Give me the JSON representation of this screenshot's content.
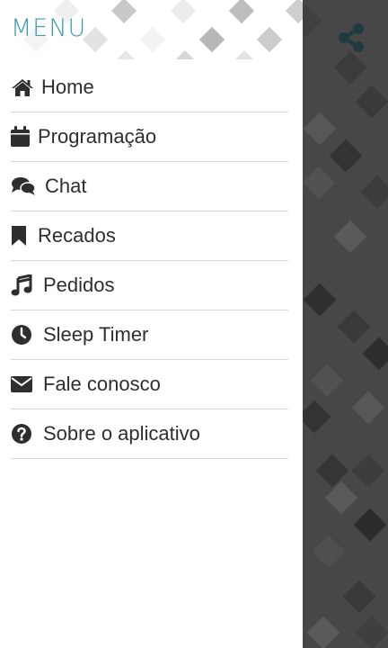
{
  "drawer": {
    "title": "MENU",
    "items": [
      {
        "label": "Home",
        "icon": "home-icon"
      },
      {
        "label": "Programação",
        "icon": "calendar-icon"
      },
      {
        "label": "Chat",
        "icon": "chat-icon"
      },
      {
        "label": "Recados",
        "icon": "bookmark-icon"
      },
      {
        "label": "Pedidos",
        "icon": "music-note-icon"
      },
      {
        "label": "Sleep Timer",
        "icon": "clock-icon"
      },
      {
        "label": "Fale conosco",
        "icon": "envelope-icon"
      },
      {
        "label": "Sobre o aplicativo",
        "icon": "question-circle-icon"
      }
    ]
  },
  "share": {
    "icon": "share-icon"
  },
  "colors": {
    "accent": "#3a9db0",
    "text": "#2e2e2e",
    "divider": "#d9d9d9",
    "background_dark": "#474747",
    "share_icon": "#1f3b3f"
  }
}
